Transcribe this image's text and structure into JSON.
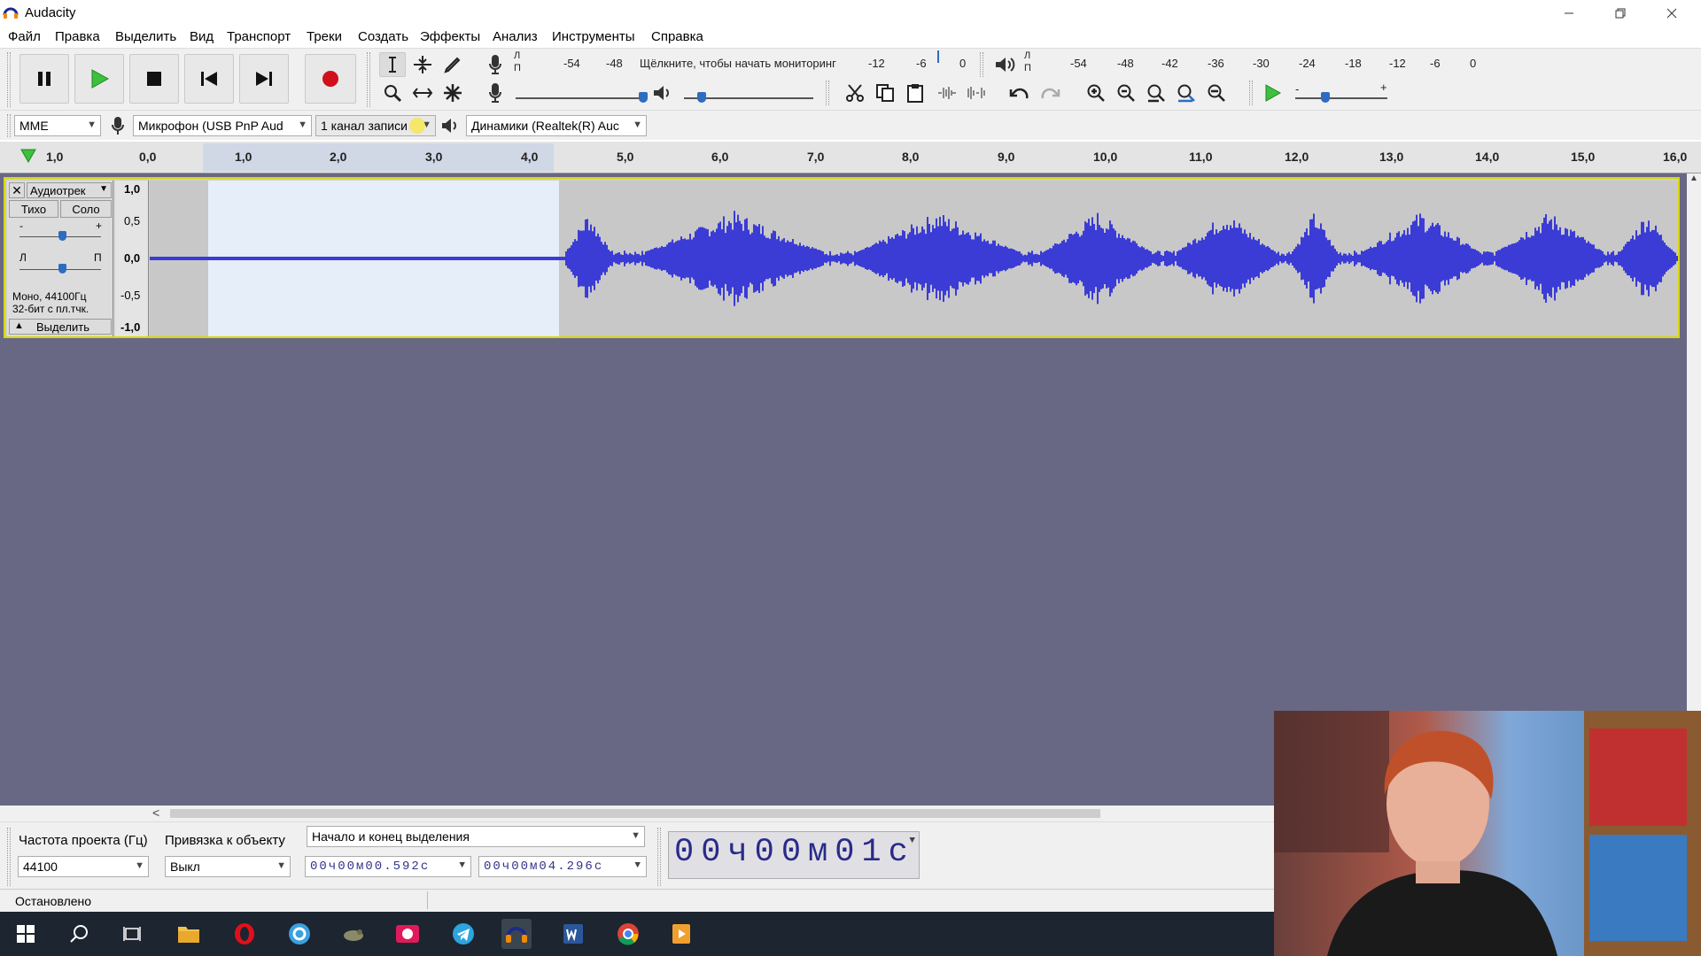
{
  "window": {
    "title": "Audacity"
  },
  "menu": [
    "Файл",
    "Правка",
    "Выделить",
    "Вид",
    "Транспорт",
    "Треки",
    "Создать",
    "Эффекты",
    "Анализ",
    "Инструменты",
    "Справка"
  ],
  "meters": {
    "record_ticks": [
      "-54",
      "-48",
      "-12",
      "-6",
      "0"
    ],
    "record_hint": "Щёлкните, чтобы начать мониторинг",
    "play_ticks": [
      "-54",
      "-48",
      "-42",
      "-36",
      "-30",
      "-24",
      "-18",
      "-12",
      "-6",
      "0"
    ],
    "lp_top": "Л",
    "lp_bottom": "П"
  },
  "device": {
    "host": "MME",
    "input": "Микрофон (USB PnP Aud",
    "channels": "1 канал записи",
    "output": "Динамики (Realtek(R) Auc"
  },
  "ruler": {
    "ticks": [
      "1,0",
      "0,0",
      "1,0",
      "2,0",
      "3,0",
      "4,0",
      "5,0",
      "6,0",
      "7,0",
      "8,0",
      "9,0",
      "10,0",
      "11,0",
      "12,0",
      "13,0",
      "14,0",
      "15,0",
      "16,0"
    ]
  },
  "track": {
    "name": "Аудиотрек",
    "mute": "Тихо",
    "solo": "Соло",
    "gain_minus": "-",
    "gain_plus": "+",
    "pan_left": "Л",
    "pan_right": "П",
    "info_line1": "Моно, 44100Гц",
    "info_line2": "32-бит с пл.тчк.",
    "select_label": "Выделить",
    "scale": [
      "1,0",
      "0,5",
      "0,0",
      "-0,5",
      "-1,0"
    ]
  },
  "selection_toolbar": {
    "rate_label": "Частота проекта (Гц)",
    "snap_label": "Привязка к объекту",
    "rate_value": "44100",
    "snap_value": "Выкл",
    "mode": "Начало и конец выделения",
    "start": "00ч00м00.592с",
    "end": "00ч00м04.296с"
  },
  "time_display": "00ч00м01с",
  "status": "Остановлено",
  "colors": {
    "waveform": "#3b3bd6",
    "selection": "#e6eefa",
    "track_bg": "#c8c8c8",
    "background": "#686884",
    "taskbar": "#1c2530"
  }
}
